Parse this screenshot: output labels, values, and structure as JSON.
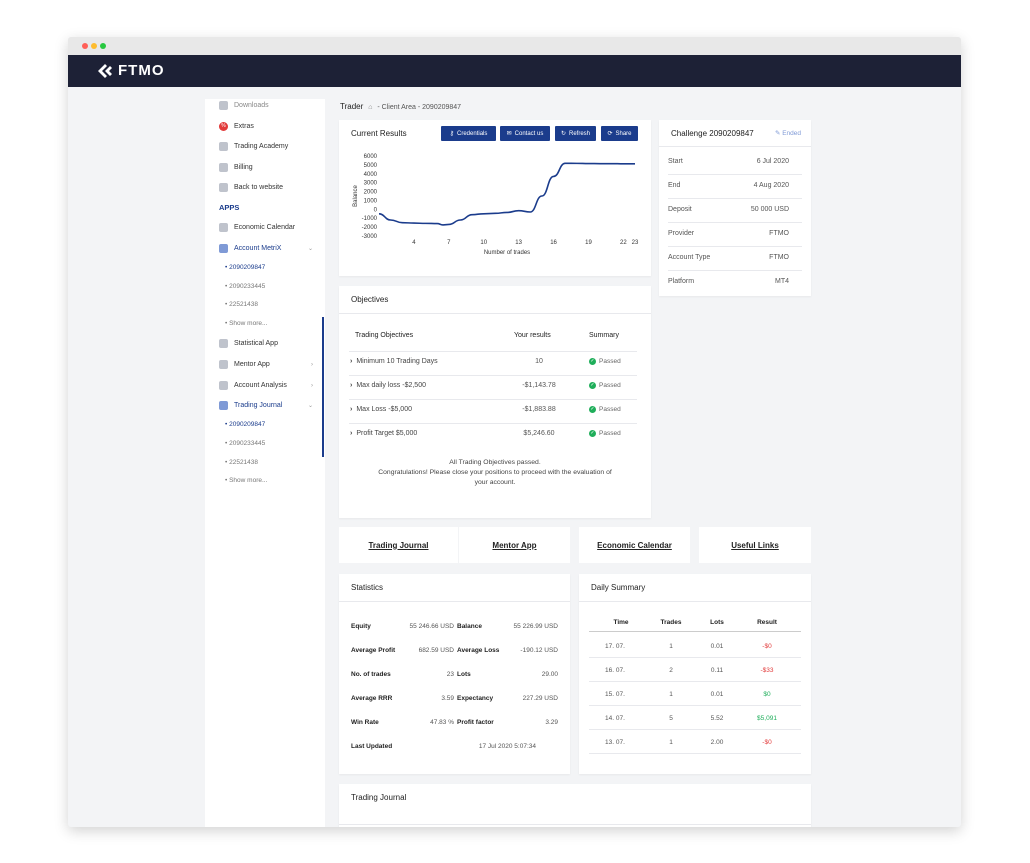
{
  "brand": {
    "name": "FTMO"
  },
  "sidebar": {
    "items_top": [
      {
        "label": "Downloads",
        "icon": "download-icon"
      },
      {
        "label": "Extras",
        "icon": "percent-icon"
      },
      {
        "label": "Trading Academy",
        "icon": "academy-icon"
      },
      {
        "label": "Billing",
        "icon": "billing-icon"
      },
      {
        "label": "Back to website",
        "icon": "back-arrow-icon"
      }
    ],
    "apps_heading": "APPS",
    "apps": [
      {
        "label": "Economic Calendar"
      },
      {
        "label": "Account MetriX"
      },
      {
        "label": "Statistical App"
      },
      {
        "label": "Mentor App"
      },
      {
        "label": "Account Analysis"
      },
      {
        "label": "Trading Journal"
      }
    ],
    "metrix_accounts": [
      "2090209847",
      "2090233445",
      "22521438",
      "Show more..."
    ],
    "journal_accounts": [
      "2090209847",
      "2090233445",
      "22521438",
      "Show more..."
    ]
  },
  "breadcrumb": {
    "title": "Trader",
    "path": "- Client Area - 2090209847"
  },
  "current_results": {
    "title": "Current Results",
    "buttons": [
      "Credentials",
      "Contact us",
      "Refresh",
      "Share"
    ]
  },
  "chart_data": {
    "type": "line",
    "xlabel": "Number of trades",
    "ylabel": "Balance",
    "x_ticks": [
      "4",
      "7",
      "10",
      "13",
      "16",
      "19",
      "22",
      "23"
    ],
    "y_ticks": [
      "6000",
      "5000",
      "4000",
      "3000",
      "2000",
      "1000",
      "0",
      "-1000",
      "-2000",
      "-3000"
    ],
    "xlim": [
      1,
      23
    ],
    "ylim": [
      -3000,
      6000
    ],
    "series": [
      {
        "x": [
          1,
          2,
          3,
          4,
          5,
          6,
          6.5,
          7,
          8,
          9,
          10,
          11,
          12,
          13,
          14,
          15,
          16,
          17,
          18,
          19,
          20,
          21,
          22,
          23
        ],
        "y": [
          -500,
          -1200,
          -1500,
          -1550,
          -1580,
          -1600,
          -1750,
          -1700,
          -1200,
          -600,
          -500,
          -450,
          -350,
          -150,
          -300,
          1500,
          3700,
          5180,
          5170,
          5150,
          5140,
          5140,
          5120,
          5120
        ]
      }
    ]
  },
  "challenge": {
    "title": "Challenge 2090209847",
    "status": "Ended",
    "rows": [
      {
        "label": "Start",
        "value": "6 Jul 2020"
      },
      {
        "label": "End",
        "value": "4 Aug 2020"
      },
      {
        "label": "Deposit",
        "value": "50 000 USD"
      },
      {
        "label": "Provider",
        "value": "FTMO"
      },
      {
        "label": "Account Type",
        "value": "FTMO"
      },
      {
        "label": "Platform",
        "value": "MT4"
      }
    ]
  },
  "objectives": {
    "title": "Objectives",
    "headers": [
      "Trading Objectives",
      "Your results",
      "Summary"
    ],
    "rows": [
      {
        "name": "Minimum 10 Trading Days",
        "result": "10",
        "summary": "Passed"
      },
      {
        "name": "Max daily loss -$2,500",
        "result": "-$1,143.78",
        "summary": "Passed"
      },
      {
        "name": "Max Loss -$5,000",
        "result": "-$1,883.88",
        "summary": "Passed"
      },
      {
        "name": "Profit Target $5,000",
        "result": "$5,246.60",
        "summary": "Passed"
      }
    ],
    "message_1": "All Trading Objectives passed.",
    "message_2": "Congratulations! Please close your positions to proceed with the evaluation of",
    "message_3": "your account."
  },
  "links": [
    "Trading Journal",
    "Mentor App",
    "Economic Calendar",
    "Useful Links"
  ],
  "statistics": {
    "title": "Statistics",
    "left": [
      {
        "label": "Equity",
        "value": "55 246.66 USD"
      },
      {
        "label": "Average Profit",
        "value": "682.59 USD"
      },
      {
        "label": "No. of trades",
        "value": "23"
      },
      {
        "label": "Average RRR",
        "value": "3.59"
      },
      {
        "label": "Win Rate",
        "value": "47.83 %"
      },
      {
        "label": "Last Updated",
        "value": "17 Jul 2020 5:07:34"
      }
    ],
    "right": [
      {
        "label": "Balance",
        "value": "55 226.99 USD"
      },
      {
        "label": "Average Loss",
        "value": "-190.12 USD"
      },
      {
        "label": "Lots",
        "value": "29.00"
      },
      {
        "label": "Expectancy",
        "value": "227.29 USD"
      },
      {
        "label": "Profit factor",
        "value": "3.29"
      }
    ]
  },
  "daily_summary": {
    "title": "Daily Summary",
    "headers": [
      "Time",
      "Trades",
      "Lots",
      "Result"
    ],
    "rows": [
      {
        "time": "17. 07.",
        "trades": "1",
        "lots": "0.01",
        "result": "-$0"
      },
      {
        "time": "16. 07.",
        "trades": "2",
        "lots": "0.11",
        "result": "-$33"
      },
      {
        "time": "15. 07.",
        "trades": "1",
        "lots": "0.01",
        "result": "$0"
      },
      {
        "time": "14. 07.",
        "trades": "5",
        "lots": "5.52",
        "result": "$5,091"
      },
      {
        "time": "13. 07.",
        "trades": "1",
        "lots": "2.00",
        "result": "-$0"
      }
    ]
  },
  "trading_journal": {
    "title": "Trading Journal"
  },
  "colors": {
    "accent": "#1b3c8c",
    "topbar": "#1d2136",
    "pass": "#1fae5a",
    "loss": "#e23b3b"
  }
}
